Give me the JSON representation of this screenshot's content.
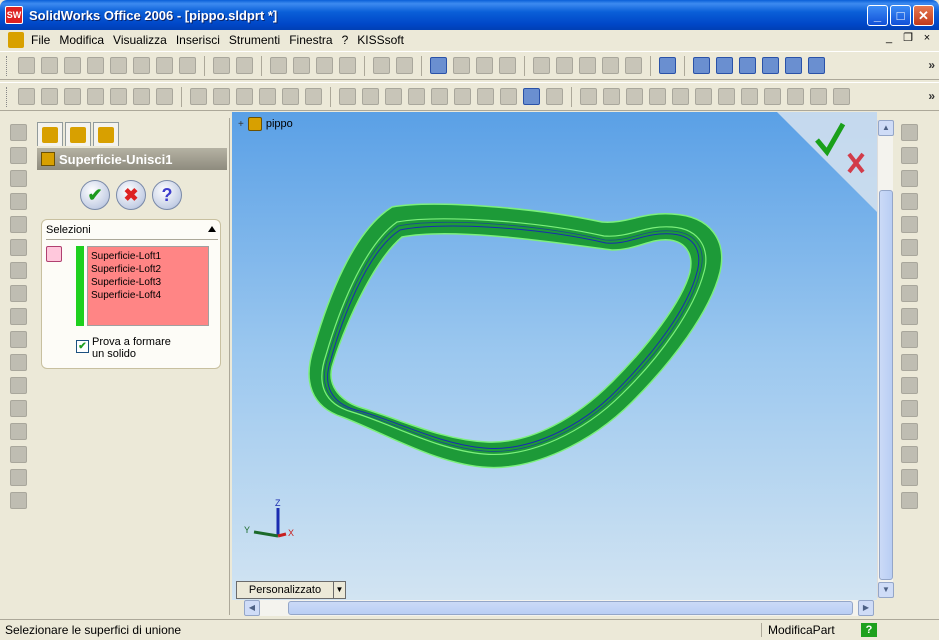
{
  "window": {
    "title": "SolidWorks Office 2006 - [pippo.sldprt *]",
    "logo_text": "SW",
    "minimize": "_",
    "maximize": "□",
    "close": "✕"
  },
  "menu": {
    "items": [
      "File",
      "Modifica",
      "Visualizza",
      "Inserisci",
      "Strumenti",
      "Finestra",
      "?",
      "KISSsoft"
    ],
    "mdi_min": "_",
    "mdi_restore": "❐",
    "mdi_close": "×"
  },
  "toolbar": {
    "more": "»"
  },
  "property_manager": {
    "feature_title": "Superficie-Unisci1",
    "ok_symbol": "✔",
    "cancel_symbol": "✖",
    "help_symbol": "?",
    "selections_label": "Selezioni",
    "selections": [
      "Superficie-Loft1",
      "Superficie-Loft2",
      "Superficie-Loft3",
      "Superficie-Loft4"
    ],
    "checkbox_label_line1": "Prova a formare",
    "checkbox_label_line2": "un solido",
    "checkbox_checked": true,
    "checkbox_mark": "✔"
  },
  "graphics": {
    "tree_plus": "+",
    "part_name": "pippo",
    "view_orientation": "Personalizzato",
    "view_dropdown": "▼",
    "triad": {
      "z": "Z",
      "y": "Y",
      "x": "X"
    },
    "model_color": "#1d9a38",
    "edge_color": "#7cf07c",
    "inner_edge_color": "#1a2cb0"
  },
  "scroll": {
    "up": "▲",
    "down": "▼",
    "left": "◀",
    "right": "▶"
  },
  "status": {
    "message": "Selezionare le superfici di unione",
    "mode": "ModificaPart",
    "help": "?"
  }
}
